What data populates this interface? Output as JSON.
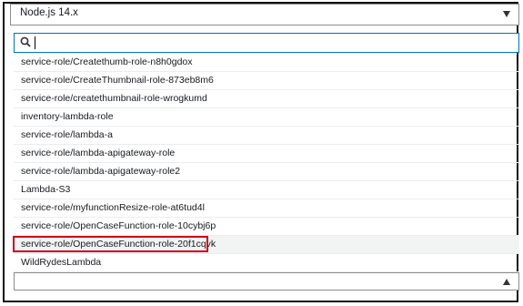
{
  "runtime_select": {
    "value": "Node.js 14.x"
  },
  "search": {
    "value": ""
  },
  "roles": [
    "service-role/Createthumb-role-n8h0gdox",
    "service-role/CreateThumbnail-role-873eb8m6",
    "service-role/createthumbnail-role-wrogkumd",
    "inventory-lambda-role",
    "service-role/lambda-a",
    "service-role/lambda-apigateway-role",
    "service-role/lambda-apigateway-role2",
    "Lambda-S3",
    "service-role/myfunctionResize-role-at6tud4l",
    "service-role/OpenCaseFunction-role-10cybj6p",
    "service-role/OpenCaseFunction-role-20f1cqvk",
    "WildRydesLambda"
  ],
  "highlight_index": 10,
  "role_select": {
    "value": ""
  },
  "colors": {
    "highlight_border": "#d0021b",
    "search_border": "#0073bb"
  }
}
